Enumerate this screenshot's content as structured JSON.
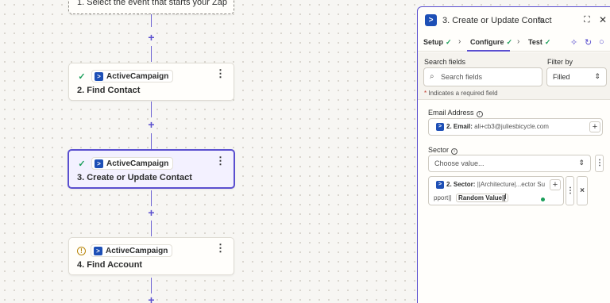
{
  "canvas": {
    "steps": [
      {
        "title": "1. Select the event that starts your Zap"
      },
      {
        "status": "complete",
        "app": "ActiveCampaign",
        "title": "2. Find Contact"
      },
      {
        "status": "complete",
        "app": "ActiveCampaign",
        "title": "3. Create or Update Contact",
        "selected": true
      },
      {
        "status": "warning",
        "app": "ActiveCampaign",
        "title": "4. Find Account"
      }
    ],
    "add_symbol": "+",
    "menu_symbol": "⋮",
    "check_symbol": "✓",
    "warning_symbol": "!"
  },
  "panel": {
    "title": "3. Create or Update Contact",
    "app_logo": "activecampaign-icon",
    "tabs": [
      {
        "label": "Setup",
        "complete": true
      },
      {
        "label": "Configure",
        "complete": true,
        "active": true
      },
      {
        "label": "Test",
        "complete": true
      }
    ],
    "search": {
      "label": "Search fields",
      "placeholder": "Search fields",
      "filter_label": "Filter by",
      "filter_value": "Filled"
    },
    "required_note": "Indicates a required field",
    "required_star": "*",
    "fields": {
      "email": {
        "label": "Email Address",
        "pill_step": "2. Email:",
        "pill_value": "ali+cb3@juliesbicycle.com"
      },
      "sector": {
        "label": "Sector",
        "placeholder": "Choose value...",
        "pill_step": "2. Sector:",
        "pill_value_line1": "||Architecture|...ector Su",
        "pill_value_line2": "pport||",
        "typed_value": "Random Value||"
      }
    }
  },
  "colors": {
    "accent": "#5a4fcf",
    "success": "#1a9e5a",
    "warning": "#b8860b",
    "brand": "#1d4fb6"
  }
}
